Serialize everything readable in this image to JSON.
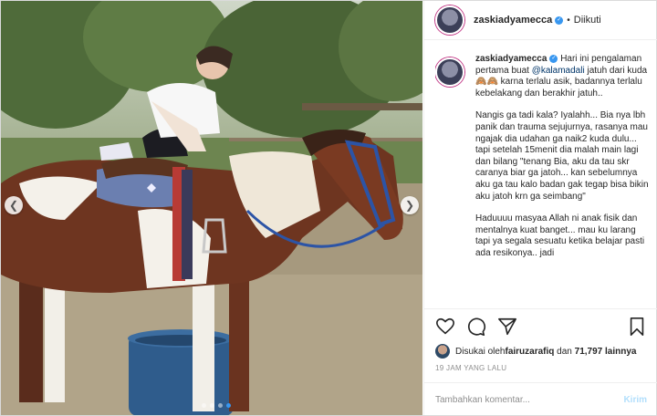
{
  "header": {
    "username": "zaskiadyamecca",
    "separator": "•",
    "follow_status": "Diikuti"
  },
  "caption": {
    "username": "zaskiadyamecca",
    "para1_a": "Hari ini pengalaman pertama buat ",
    "mention": "@kalamadali",
    "para1_b": " jatuh dari kuda🙈🙈 karna terlalu asik, badannya terlalu kebelakang dan berakhir jatuh..",
    "para2": "Nangis ga tadi kala? Iyalahh... Bia nya lbh panik dan trauma sejujurnya, rasanya mau ngajak dia udahan ga naik2 kuda dulu... tapi setelah 15menit dia malah main lagi dan bilang \"tenang Bia, aku da tau skr caranya biar ga jatoh... kan sebelumnya aku ga tau kalo badan gak tegap bisa bikin aku jatoh krn ga seimbang\"",
    "para3": "Haduuuu masyaa Allah ni anak fisik dan mentalnya kuat banget... mau ku larang tapi ya segala sesuatu ketika belajar pasti ada resikonya.. jadi"
  },
  "likes": {
    "prefix": "Disukai oleh ",
    "user": "fairuzarafiq",
    "middle": " dan ",
    "count": "71,797 lainnya"
  },
  "timestamp": "19 JAM YANG LALU",
  "comment": {
    "placeholder": "Tambahkan komentar...",
    "post_label": "Kirim"
  },
  "carousel": {
    "prev_icon": "chevron-left-icon",
    "next_icon": "chevron-right-icon",
    "active_dot": 3,
    "dot_count": 4
  },
  "colors": {
    "link": "#003569",
    "accent": "#3897f0",
    "muted": "#8e8e8e",
    "post_disabled": "#b2dffc"
  }
}
